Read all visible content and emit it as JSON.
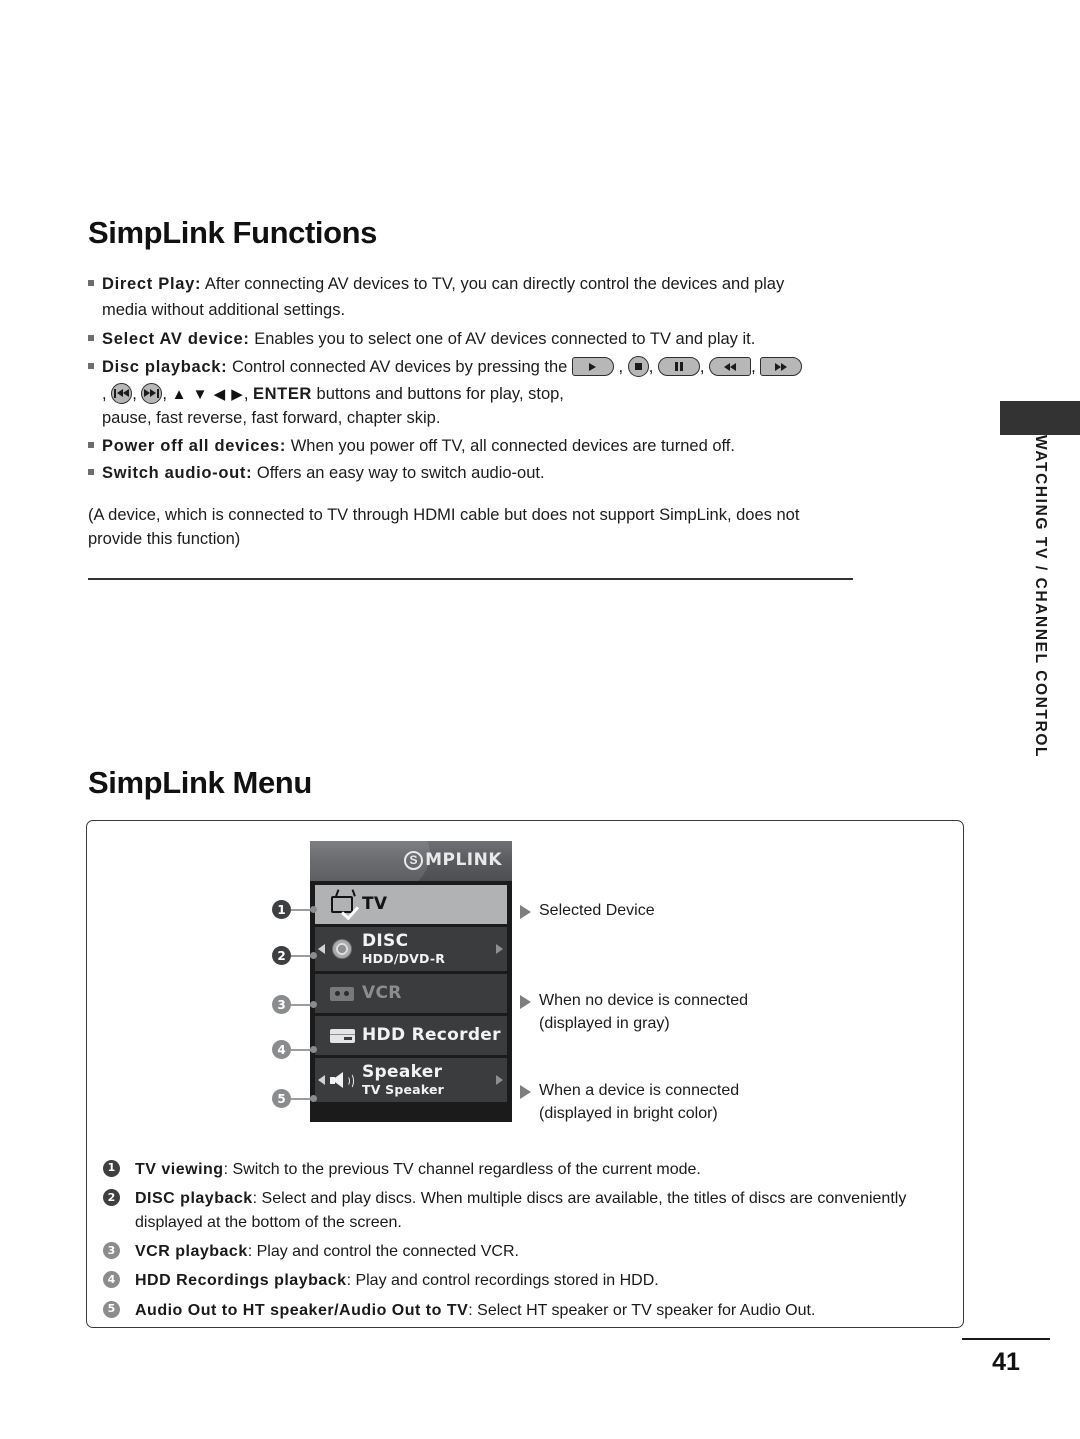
{
  "document": {
    "page_number": "41",
    "edge_tab_label": "WATCHING TV / CHANNEL CONTROL"
  },
  "functions_section": {
    "title": "SimpLink Functions",
    "bullets": [
      {
        "lead": "Direct Play:",
        "text": " After connecting AV devices to TV, you can directly control the devices and play",
        "continuation": "media without additional settings."
      },
      {
        "lead": "Select AV device:",
        "text": " Enables you to select one of AV devices connected to TV and play it."
      },
      {
        "lead": "Disc playback:",
        "text": " Control connected AV devices by pressing the",
        "keys_row1": [
          "play-key",
          "stop-key",
          "pause-key",
          "rewind-key",
          "fast-forward-key"
        ],
        "keys_row2": [
          "skip-back-key",
          "skip-forward-key"
        ],
        "arrows": "▲ ▼ ◀ ▶",
        "enter": "ENTER",
        "after_enter": " buttons and buttons for play, stop,",
        "continuation": "pause, fast reverse, fast forward, chapter skip."
      },
      {
        "lead": "Power off all devices:",
        "text": " When you power off TV, all connected devices are turned off."
      },
      {
        "lead": "Switch audio-out:",
        "text": " Offers an easy way to switch audio-out."
      }
    ],
    "note": "(A device, which is connected to TV through HDMI cable but does not support SimpLink, does not provide this function)"
  },
  "menu_section": {
    "title": "SimpLink Menu",
    "osd": {
      "logo_mark": "S",
      "logo_word": "MPLINK",
      "rows": [
        {
          "id": 1,
          "icon": "tv-icon",
          "label": "TV",
          "sublabel": "",
          "state": "selected",
          "left_arrow": false,
          "right_arrow": false
        },
        {
          "id": 2,
          "icon": "disc-icon",
          "label": "DISC",
          "sublabel": "HDD/DVD-R",
          "state": "bright",
          "left_arrow": true,
          "right_arrow": true
        },
        {
          "id": 3,
          "icon": "vcr-icon",
          "label": "VCR",
          "sublabel": "",
          "state": "dim",
          "left_arrow": false,
          "right_arrow": false
        },
        {
          "id": 4,
          "icon": "hdd-icon",
          "label": "HDD Recorder",
          "sublabel": "",
          "state": "bright",
          "left_arrow": false,
          "right_arrow": false
        },
        {
          "id": 5,
          "icon": "speaker-icon",
          "label": "Speaker",
          "sublabel": "TV Speaker",
          "state": "bright",
          "left_arrow": true,
          "right_arrow": true
        }
      ]
    },
    "annotations": [
      {
        "line1": "Selected  Device",
        "line2": ""
      },
      {
        "line1": "When no device is connected",
        "line2": "(displayed in gray)"
      },
      {
        "line1": "When a device is connected",
        "line2": "(displayed in bright color)"
      }
    ],
    "descriptions": [
      {
        "num": "1",
        "term": "TV viewing",
        "text": ": Switch to the previous TV channel regardless of the current mode."
      },
      {
        "num": "2",
        "term": "DISC playback",
        "text": ": Select and play discs. When multiple discs are available, the titles of discs are conveniently displayed at the bottom of the screen."
      },
      {
        "num": "3",
        "term": "VCR playback",
        "text": ": Play and control the connected VCR."
      },
      {
        "num": "4",
        "term": "HDD Recordings playback",
        "text": ": Play and control recordings stored in HDD."
      },
      {
        "num": "5",
        "term": "Audio Out to HT speaker/Audio Out to TV",
        "text": ": Select HT speaker or TV speaker for Audio Out."
      }
    ]
  },
  "colors": {
    "text": "#1c1c1c",
    "rule": "#333333",
    "osd_selected_bg": "#b0b2b4",
    "osd_row_bg": "#3a3c3e",
    "osd_dim_text": "#8b8d8f",
    "osd_bright_text": "#f2f2f2",
    "badge_bg": "#3d3f41"
  }
}
